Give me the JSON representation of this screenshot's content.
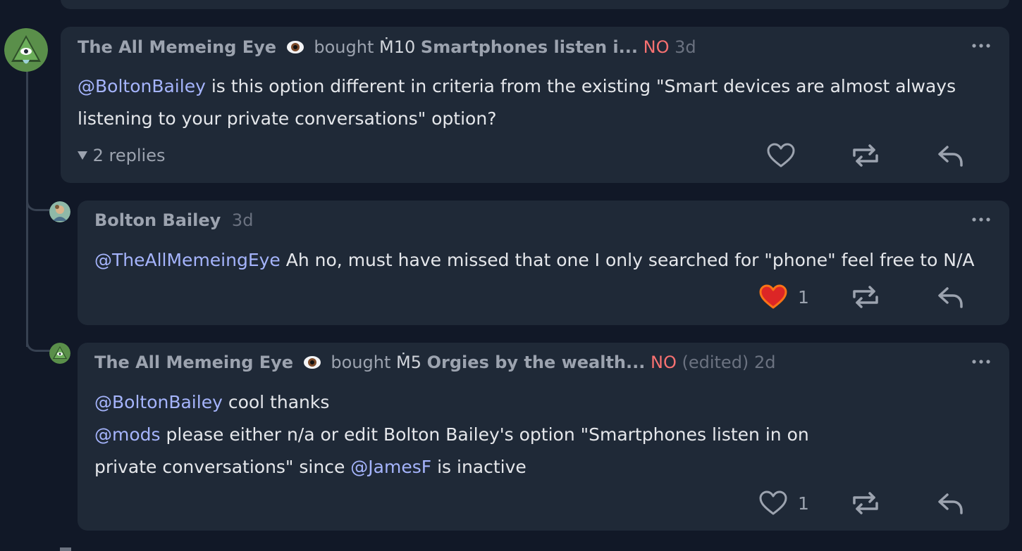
{
  "comments": [
    {
      "author": "The All Memeing Eye",
      "action": "bought",
      "mana_symbol": "Ṁ",
      "amount": "10",
      "question": "Smartphones listen i...",
      "outcome": "NO",
      "time": "3d",
      "mention": "@BoltonBailey",
      "text": "is this option different in criteria from the existing \"Smart devices are almost always listening to your private conversations\" option?",
      "replies_label": "2 replies"
    },
    {
      "author": "Bolton Bailey",
      "time": "3d",
      "mention": "@TheAllMemeingEye",
      "text": "Ah no, must have missed that one I only searched for \"phone\" feel free to N/A",
      "likes": "1"
    },
    {
      "author": "The All Memeing Eye",
      "action": "bought",
      "mana_symbol": "Ṁ",
      "amount": "5",
      "question": "Orgies by the wealth...",
      "outcome": "NO",
      "edited": "(edited)",
      "time": "2d",
      "line1_mention": "@BoltonBailey",
      "line1_text": "cool thanks",
      "line2_mention": "@mods",
      "line2_text": "please either n/a or edit Bolton Bailey's option \"Smartphones listen in on private conversations\" since",
      "line2_mention2": "@JamesF",
      "line2_tail": "is inactive",
      "likes": "1"
    }
  ],
  "icons": {
    "like": "heart-outline-icon",
    "liked": "heart-filled-icon",
    "repost": "repost-icon",
    "reply": "reply-icon",
    "more": "more-dots-icon",
    "eye": "eye-emoji-icon",
    "caret": "caret-down-icon"
  },
  "colors": {
    "background": "#111827",
    "card": "#1f2937",
    "mention": "#a5b4fc",
    "no_outcome": "#f87171",
    "heart_filled": "#dc2626"
  }
}
